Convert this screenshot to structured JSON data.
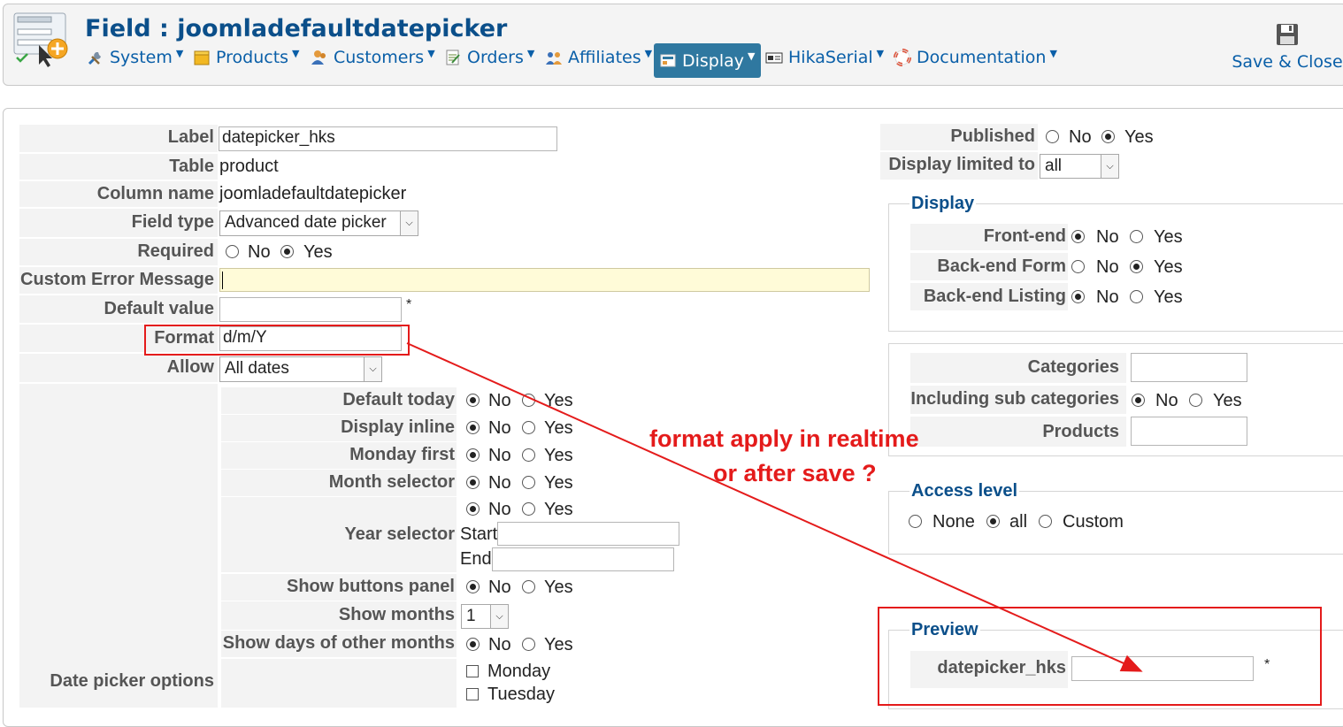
{
  "header": {
    "title": "Field : joomladefaultdatepicker",
    "save_close": "Save & Close",
    "menus": [
      "System",
      "Products",
      "Customers",
      "Orders",
      "Affiliates",
      "Display",
      "HikaSerial",
      "Documentation"
    ],
    "active_menu": "Display"
  },
  "form": {
    "label": {
      "label": "Label",
      "value": "datepicker_hks"
    },
    "table": {
      "label": "Table",
      "value": "product"
    },
    "column_name": {
      "label": "Column name",
      "value": "joomladefaultdatepicker"
    },
    "field_type": {
      "label": "Field type",
      "value": "Advanced date picker"
    },
    "required": {
      "label": "Required",
      "no": "No",
      "yes": "Yes",
      "selected": "Yes"
    },
    "custom_error": {
      "label": "Custom Error Message",
      "value": ""
    },
    "default_value": {
      "label": "Default value",
      "value": "",
      "required_mark": "*"
    },
    "format": {
      "label": "Format",
      "value": "d/m/Y"
    },
    "allow": {
      "label": "Allow",
      "value": "All dates"
    }
  },
  "datepicker": {
    "section_label": "Date picker options",
    "no": "No",
    "yes": "Yes",
    "options": [
      {
        "label": "Default today",
        "selected": "No"
      },
      {
        "label": "Display inline",
        "selected": "No"
      },
      {
        "label": "Monday first",
        "selected": "No"
      },
      {
        "label": "Month selector",
        "selected": "No"
      },
      {
        "label": "Year selector",
        "selected": "No"
      },
      {
        "label": "Show buttons panel",
        "selected": "No"
      },
      {
        "label": "Show months",
        "selected": "1"
      },
      {
        "label": "Show days of other months",
        "selected": "No"
      }
    ],
    "year_start_label": "Start",
    "year_end_label": "End",
    "show_months_value": "1",
    "days": [
      "Monday",
      "Tuesday"
    ]
  },
  "right": {
    "published": {
      "label": "Published",
      "no": "No",
      "yes": "Yes",
      "selected": "Yes"
    },
    "display_limited": {
      "label": "Display limited to",
      "value": "all"
    },
    "display": {
      "legend": "Display",
      "no": "No",
      "yes": "Yes",
      "rows": [
        {
          "label": "Front-end",
          "selected": "No"
        },
        {
          "label": "Back-end Form",
          "selected": "Yes"
        },
        {
          "label": "Back-end Listing",
          "selected": "No"
        }
      ]
    },
    "categories": {
      "label": "Categories",
      "value": ""
    },
    "subcats": {
      "label": "Including sub categories",
      "no": "No",
      "yes": "Yes",
      "selected": "No"
    },
    "products": {
      "label": "Products",
      "value": ""
    },
    "access": {
      "legend": "Access level",
      "none": "None",
      "all": "all",
      "custom": "Custom",
      "selected": "all"
    },
    "preview": {
      "legend": "Preview",
      "label": "datepicker_hks",
      "value": "",
      "required_mark": "*"
    }
  },
  "annotation": {
    "line1": "format apply in realtime",
    "line2": "or after save ?"
  },
  "colors": {
    "accent": "#0b4f8a",
    "link": "#0a5fa8",
    "active_menu": "#2f78a0",
    "annotation": "#e41b1b",
    "error_input_bg": "#fffbd8"
  }
}
